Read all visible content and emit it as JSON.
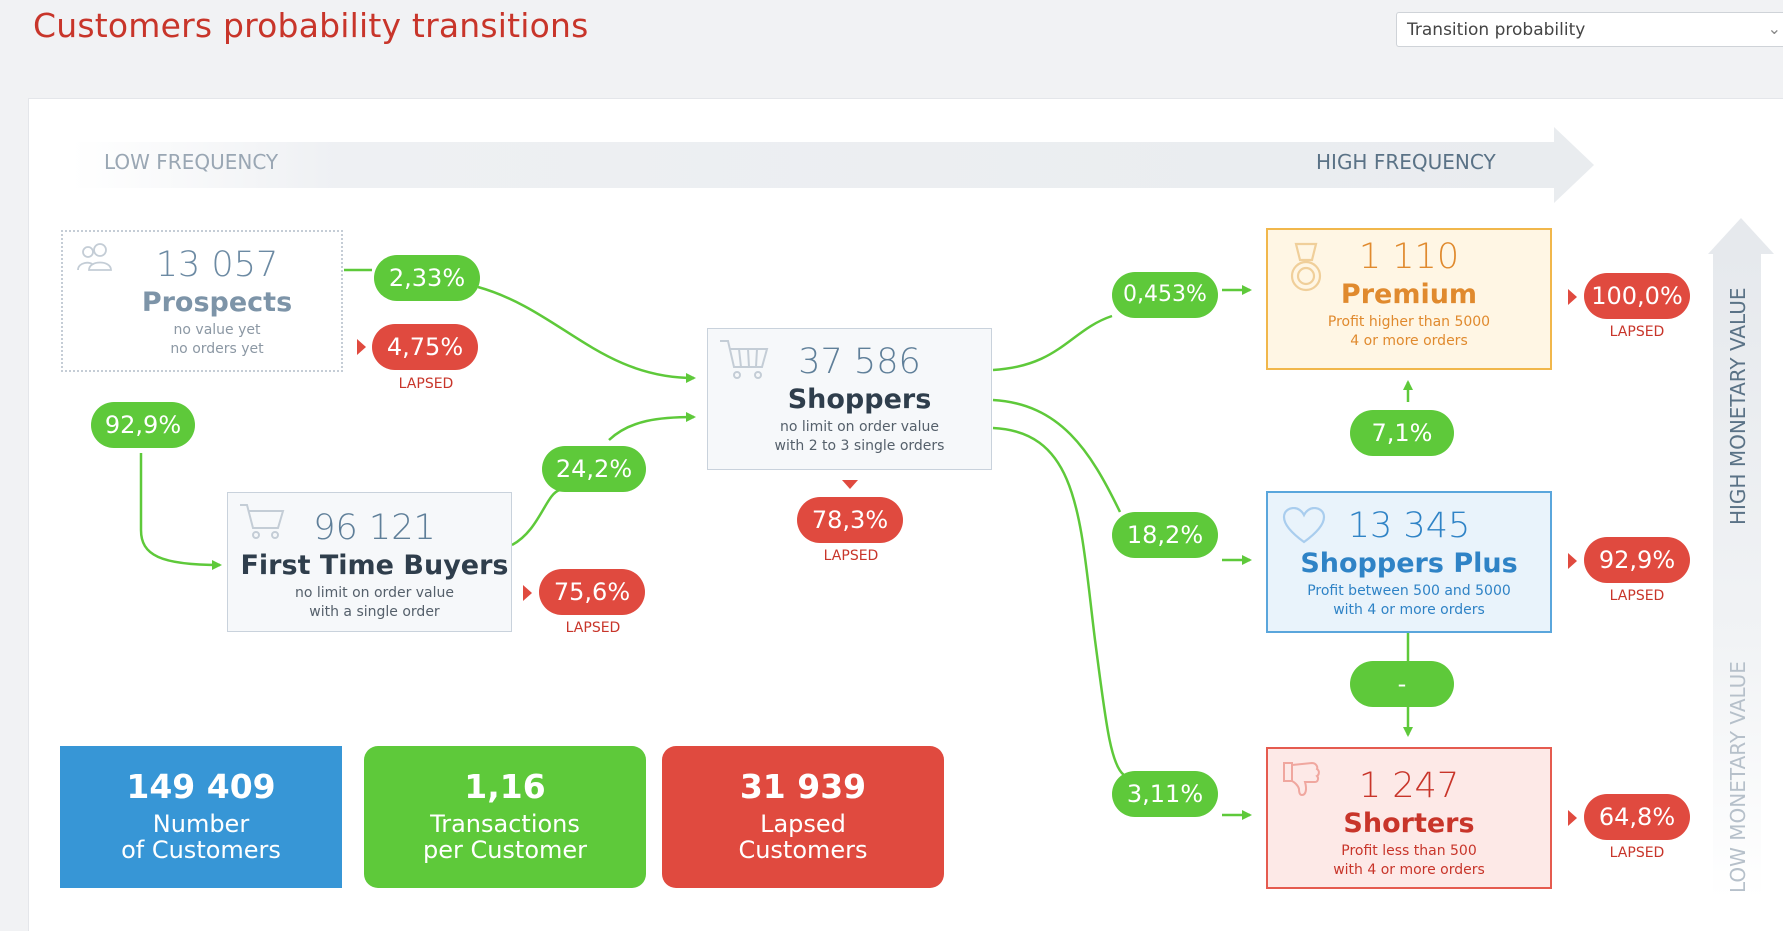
{
  "title": "Customers probability transitions",
  "dropdown": {
    "selected": "Transition probability"
  },
  "axes": {
    "low_frequency": "LOW FREQUENCY",
    "high_frequency": "HIGH FREQUENCY",
    "high_monetary": "HIGH MONETARY VALUE",
    "low_monetary": "LOW MONETARY VALUE"
  },
  "segments": {
    "prospects": {
      "count": "13 057",
      "name": "Prospects",
      "desc1": "no value yet",
      "desc2": "no orders yet",
      "icon": "users-icon"
    },
    "first_time_buyers": {
      "count": "96 121",
      "name": "First Time Buyers",
      "desc1": "no limit on order value",
      "desc2": "with a single order",
      "icon": "cart-icon"
    },
    "shoppers": {
      "count": "37 586",
      "name": "Shoppers",
      "desc1": "no limit on order value",
      "desc2": "with 2 to 3 single orders",
      "icon": "cart-icon"
    },
    "premium": {
      "count": "1 110",
      "name": "Premium",
      "desc1": "Profit higher than 5000",
      "desc2": "4 or more orders",
      "icon": "medal-icon"
    },
    "shoppers_plus": {
      "count": "13 345",
      "name": "Shoppers Plus",
      "desc1": "Profit between 500 and 5000",
      "desc2": "with 4 or more orders",
      "icon": "heart-icon"
    },
    "shorters": {
      "count": "1 247",
      "name": "Shorters",
      "desc1": "Profit less than 500",
      "desc2": "with 4 or more orders",
      "icon": "thumbs-down-icon"
    }
  },
  "transitions": {
    "prospects_to_shoppers": "2,33%",
    "prospects_to_first_time": "92,9%",
    "first_time_to_shoppers": "24,2%",
    "shoppers_to_premium": "0,453%",
    "shoppers_to_shoppers_plus": "18,2%",
    "shoppers_to_shorters": "3,11%",
    "shoppers_plus_to_premium": "7,1%",
    "shoppers_plus_to_shorters": "-"
  },
  "lapsed": {
    "label": "LAPSED",
    "prospects": "4,75%",
    "first_time_buyers": "75,6%",
    "shoppers": "78,3%",
    "premium": "100,0%",
    "shoppers_plus": "92,9%",
    "shorters": "64,8%"
  },
  "kpis": {
    "customers": {
      "value": "149 409",
      "line1": "Number",
      "line2": "of Customers"
    },
    "transactions": {
      "value": "1,16",
      "line1": "Transactions",
      "line2": "per Customer"
    },
    "lapsed": {
      "value": "31 939",
      "line1": "Lapsed",
      "line2": "Customers"
    }
  },
  "colors": {
    "title": "#c8352a",
    "green": "#5ec93a",
    "red": "#e04a3f",
    "blue": "#3796d6",
    "premium": "#e08a2e",
    "shoppers_plus": "#2f83c6"
  }
}
